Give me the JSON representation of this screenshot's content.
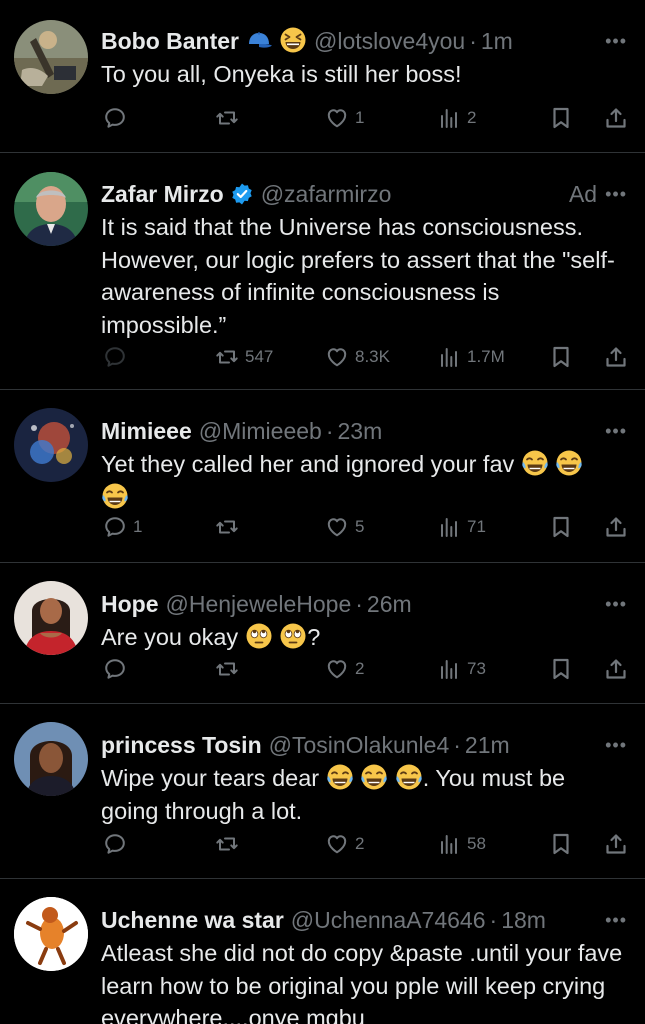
{
  "tweets": [
    {
      "name": "Bobo Banter",
      "badges": [
        "blue-cap",
        "grinning-squint"
      ],
      "handle": "@lotslove4you",
      "time": "1m",
      "text": "To you all, Onyeka is still her boss!",
      "reply_count": "",
      "retweet_count": "",
      "like_count": "1",
      "view_count": "2",
      "is_ad": false
    },
    {
      "name": "Zafar Mirzo",
      "verified": true,
      "handle": "@zafarmirzo",
      "time": "",
      "ad_label": "Ad",
      "text": "It is said that the Universe has consciousness. However, our logic prefers to assert that the \"self-awareness of infinite consciousness is impossible.”",
      "reply_count": "",
      "retweet_count": "547",
      "like_count": "8.3K",
      "view_count": "1.7M",
      "is_ad": true
    },
    {
      "name": "Mimieee",
      "handle": "@Mimieeeb",
      "time": "23m",
      "text_before": "Yet they called her and ignored your fav",
      "emoji": "face-with-tears-of-joy",
      "reply_count": "1",
      "retweet_count": "",
      "like_count": "5",
      "view_count": "71"
    },
    {
      "name": "Hope",
      "handle": "@HenjeweleHope",
      "time": "26m",
      "text_before": "Are you okay",
      "text_after": "?",
      "emoji": "face-with-rolling-eyes",
      "reply_count": "",
      "retweet_count": "",
      "like_count": "2",
      "view_count": "73"
    },
    {
      "name": "princess Tosin",
      "handle": "@TosinOlakunle4",
      "time": "21m",
      "text_before": "Wipe your tears dear",
      "text_after": ". You must be going through a lot.",
      "emoji": "face-with-tears-of-joy",
      "reply_count": "",
      "retweet_count": "",
      "like_count": "2",
      "view_count": "58"
    },
    {
      "name": "Uchenne wa star",
      "handle": "@UchennaA74646",
      "time": "18m",
      "text": "Atleast she did not do copy &paste .until your fave learn how to be original you pple will keep crying everywhere....onye mgbu"
    }
  ],
  "meta": {
    "separator": "·",
    "more_label": "•••"
  },
  "colors": {
    "background": "#000000",
    "text": "#e7e9ea",
    "muted": "#71767b",
    "divider": "#2f3336",
    "verified": "#1d9bf0"
  }
}
